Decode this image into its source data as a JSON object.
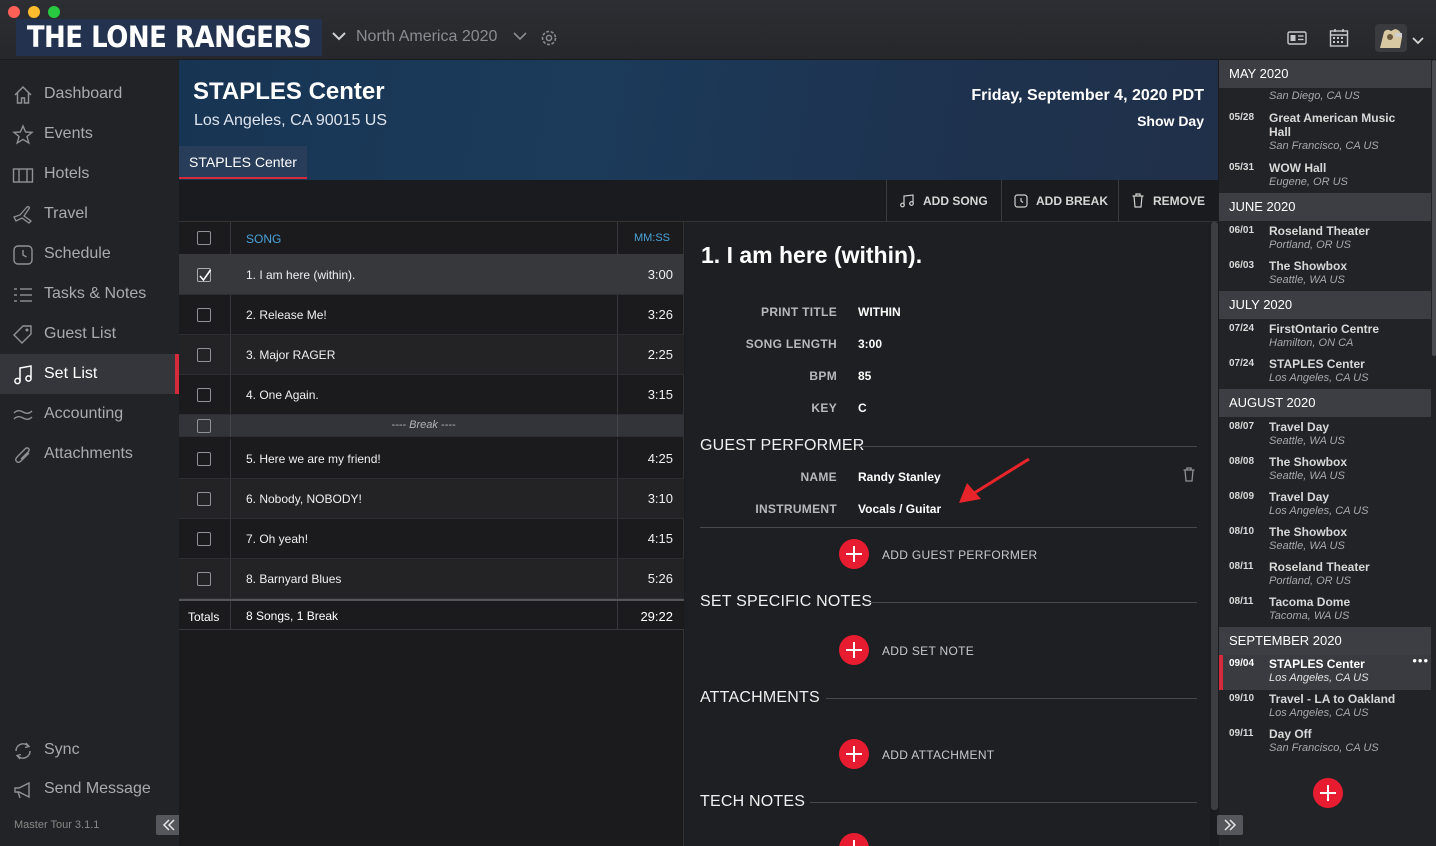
{
  "app": {
    "brand": "THE LONE RANGERS",
    "tour": "North America 2020",
    "version": "Master Tour 3.1.1"
  },
  "colors": {
    "accent": "#d42a3c",
    "add_button": "#e81c30",
    "link": "#4aa3d9",
    "header": "#1c3a5a"
  },
  "sidebar": {
    "items": [
      {
        "label": "Dashboard",
        "icon": "home-icon"
      },
      {
        "label": "Events",
        "icon": "star-icon"
      },
      {
        "label": "Hotels",
        "icon": "hotel-icon"
      },
      {
        "label": "Travel",
        "icon": "travel-icon"
      },
      {
        "label": "Schedule",
        "icon": "clock-icon"
      },
      {
        "label": "Tasks & Notes",
        "icon": "list-icon"
      },
      {
        "label": "Guest List",
        "icon": "tag-icon"
      },
      {
        "label": "Set List",
        "icon": "music-icon"
      },
      {
        "label": "Accounting",
        "icon": "money-icon"
      },
      {
        "label": "Attachments",
        "icon": "paperclip-icon"
      }
    ],
    "active": "Set List",
    "sync": "Sync",
    "send_message": "Send Message"
  },
  "header": {
    "venue_name": "STAPLES Center",
    "venue_city": "Los Angeles, CA 90015 US",
    "date": "Friday, September 4, 2020 PDT",
    "day_type": "Show Day",
    "venue_tab": "STAPLES Center"
  },
  "toolbar": {
    "add_song": "ADD SONG",
    "add_break": "ADD BREAK",
    "remove": "REMOVE"
  },
  "setlist": {
    "col_song": "SONG",
    "col_time": "MM:SS",
    "rows": [
      {
        "name": "1. I am here (within).",
        "time": "3:00",
        "checked": true
      },
      {
        "name": "2. Release Me!",
        "time": "3:26",
        "checked": false
      },
      {
        "name": "3. Major RAGER",
        "time": "2:25",
        "checked": false
      },
      {
        "name": "4. One Again.",
        "time": "3:15",
        "checked": false
      },
      {
        "name": "5. Here we are my friend!",
        "time": "4:25",
        "checked": false
      },
      {
        "name": "6. Nobody, NOBODY!",
        "time": "3:10",
        "checked": false
      },
      {
        "name": "7. Oh yeah!",
        "time": "4:15",
        "checked": false
      },
      {
        "name": "8. Barnyard Blues",
        "time": "5:26",
        "checked": false
      }
    ],
    "break_label": "---- Break ----",
    "totals_label": "Totals",
    "totals_count": "8 Songs, 1 Break",
    "totals_time": "29:22"
  },
  "detail": {
    "title": "1. I am here (within).",
    "fields": [
      {
        "label": "PRINT TITLE",
        "value": "WITHIN"
      },
      {
        "label": "SONG LENGTH",
        "value": "3:00"
      },
      {
        "label": "BPM",
        "value": "85"
      },
      {
        "label": "KEY",
        "value": "C"
      }
    ],
    "guest_section": "GUEST PERFORMER",
    "guest_name_label": "NAME",
    "guest_name": "Randy Stanley",
    "guest_instrument_label": "INSTRUMENT",
    "guest_instrument": "Vocals / Guitar",
    "add_guest": "ADD GUEST PERFORMER",
    "notes_section": "SET SPECIFIC NOTES",
    "add_note": "ADD SET NOTE",
    "attachments_section": "ATTACHMENTS",
    "add_attachment": "ADD ATTACHMENT",
    "tech_section": "TECH NOTES"
  },
  "schedule": {
    "months": [
      {
        "label": "MAY 2020",
        "events": [
          {
            "date": "",
            "venue": "",
            "city": "San Diego, CA US"
          },
          {
            "date": "05/28",
            "venue": "Great American Music Hall",
            "city": "San Francisco, CA US"
          },
          {
            "date": "05/31",
            "venue": "WOW Hall",
            "city": "Eugene, OR US"
          }
        ]
      },
      {
        "label": "JUNE 2020",
        "events": [
          {
            "date": "06/01",
            "venue": "Roseland Theater",
            "city": "Portland, OR US"
          },
          {
            "date": "06/03",
            "venue": "The Showbox",
            "city": "Seattle, WA US"
          }
        ]
      },
      {
        "label": "JULY 2020",
        "events": [
          {
            "date": "07/24",
            "venue": "FirstOntario Centre",
            "city": "Hamilton, ON CA"
          },
          {
            "date": "07/24",
            "venue": "STAPLES Center",
            "city": "Los Angeles, CA US"
          }
        ]
      },
      {
        "label": "AUGUST 2020",
        "events": [
          {
            "date": "08/07",
            "venue": "Travel Day",
            "city": "Seattle, WA US"
          },
          {
            "date": "08/08",
            "venue": "The Showbox",
            "city": "Seattle, WA US"
          },
          {
            "date": "08/09",
            "venue": "Travel Day",
            "city": "Los Angeles, CA US"
          },
          {
            "date": "08/10",
            "venue": "The Showbox",
            "city": "Seattle, WA US"
          },
          {
            "date": "08/11",
            "venue": "Roseland Theater",
            "city": "Portland, OR US"
          },
          {
            "date": "08/11",
            "venue": "Tacoma Dome",
            "city": "Tacoma, WA US"
          }
        ]
      },
      {
        "label": "SEPTEMBER 2020",
        "events": [
          {
            "date": "09/04",
            "venue": "STAPLES Center",
            "city": "Los Angeles, CA US",
            "active": true
          },
          {
            "date": "09/10",
            "venue": "Travel - LA to Oakland",
            "city": "Los Angeles, CA US"
          },
          {
            "date": "09/11",
            "venue": "Day Off",
            "city": "San Francisco, CA US"
          }
        ]
      }
    ],
    "more": "•••"
  }
}
